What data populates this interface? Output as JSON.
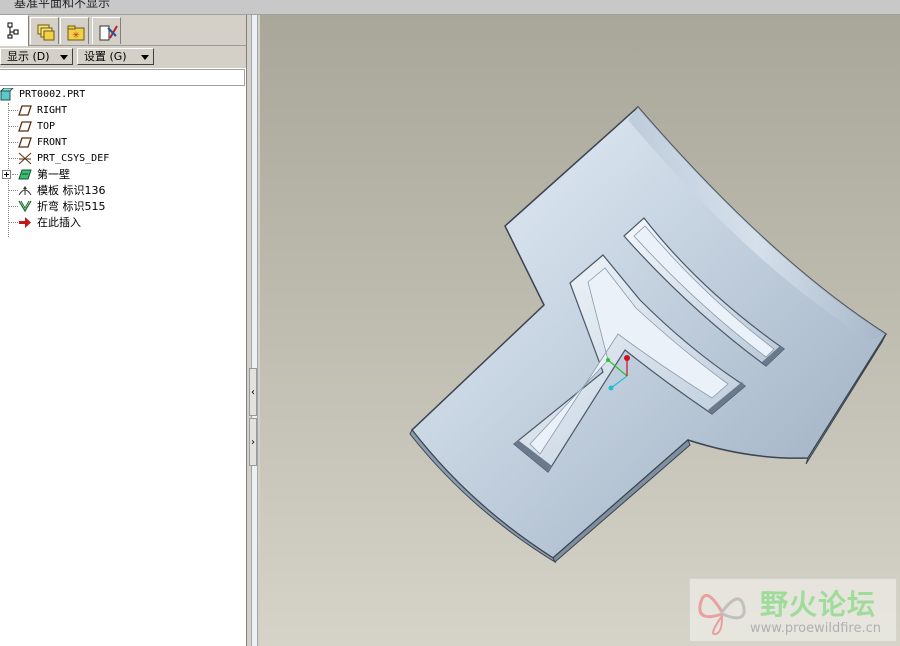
{
  "window": {
    "title": "基准平面和不显示"
  },
  "tabs": [
    {
      "name": "model-tree-tab",
      "active": true
    },
    {
      "name": "folder-browser-tab",
      "active": false
    },
    {
      "name": "favorites-tab",
      "active": false
    },
    {
      "name": "connections-tab",
      "active": false
    }
  ],
  "toolbar": {
    "display_label": "显示 (D)",
    "settings_label": "设置 (G)"
  },
  "filter": {
    "value": ""
  },
  "tree": {
    "items": [
      {
        "label": "PRT0002.PRT",
        "icon": "part-icon"
      },
      {
        "label": "RIGHT",
        "icon": "datum-plane-icon"
      },
      {
        "label": "TOP",
        "icon": "datum-plane-icon"
      },
      {
        "label": "FRONT",
        "icon": "datum-plane-icon"
      },
      {
        "label": "PRT_CSYS_DEF",
        "icon": "csys-icon"
      },
      {
        "label": "第一壁",
        "icon": "first-wall-icon",
        "expander": "+"
      },
      {
        "label": "模板 标识136",
        "icon": "form-icon"
      },
      {
        "label": "折弯 标识515",
        "icon": "bend-icon"
      },
      {
        "label": "在此插入",
        "icon": "insert-here-arrow-icon"
      }
    ]
  },
  "splitter": {
    "collapse_glyph": "‹",
    "expand_glyph": "›"
  },
  "watermark": {
    "title": "野火论坛",
    "url": "www.proewildfire.cn"
  }
}
